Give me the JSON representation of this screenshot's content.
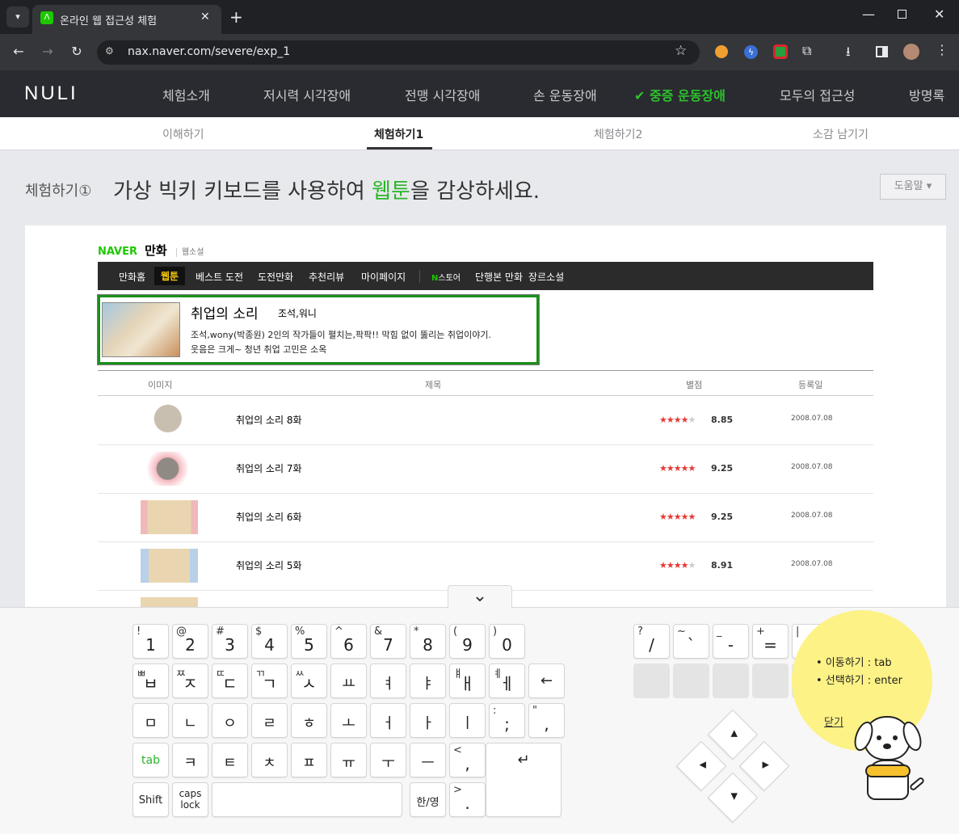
{
  "browser": {
    "tab_title": "온라인 웹 접근성 체험",
    "url": "nax.naver.com/severe/exp_1"
  },
  "nuli": {
    "logo": "NULI",
    "nav": [
      "체험소개",
      "저시력 시각장애",
      "전맹 시각장애",
      "손 운동장애",
      "중증 운동장애",
      "모두의 접근성",
      "방명록"
    ],
    "active_nav_check": "✔",
    "sub_nav": [
      "이해하기",
      "체험하기1",
      "체험하기2",
      "소감 남기기"
    ]
  },
  "page": {
    "step_label": "체험하기①",
    "title_before": "가상 빅키 키보드를 사용하여 ",
    "title_highlight": "웹툰",
    "title_after": "을 감상하세요.",
    "help_button": "도움말 ▾"
  },
  "naver": {
    "brand": "NAVER",
    "section": "만화",
    "sub_section": "웹소설",
    "menu": [
      "만화홈",
      "웹툰",
      "베스트 도전",
      "도전만화",
      "추천리뷰",
      "마이페이지"
    ],
    "store_n": "N",
    "store_label": "스토어",
    "store_items": [
      "단행본 만화",
      "장르소설"
    ],
    "featured": {
      "title": "취업의 소리",
      "authors": "조석,워니",
      "desc1": "조석,wony(박종원) 2인의 작가들이 펼치는,팍팍!! 막힘 없이 뚫리는 취업이야기.",
      "desc2": "웃음은 크게~ 청년 취업 고민은 소옥"
    },
    "table_headers": [
      "이미지",
      "제목",
      "별점",
      "등록일"
    ],
    "episodes": [
      {
        "title": "취업의 소리 8화",
        "rating": "8.85",
        "date": "2008.07.08"
      },
      {
        "title": "취업의 소리 7화",
        "rating": "9.25",
        "date": "2008.07.08"
      },
      {
        "title": "취업의 소리 6화",
        "rating": "9.25",
        "date": "2008.07.08"
      },
      {
        "title": "취업의 소리 5화",
        "rating": "8.91",
        "date": "2008.07.08"
      }
    ]
  },
  "keyboard": {
    "row1": [
      [
        "!",
        "1"
      ],
      [
        "@",
        "2"
      ],
      [
        "#",
        "3"
      ],
      [
        "$",
        "4"
      ],
      [
        "%",
        "5"
      ],
      [
        "^",
        "6"
      ],
      [
        "&",
        "7"
      ],
      [
        "*",
        "8"
      ],
      [
        "(",
        "9"
      ],
      [
        ")",
        "0"
      ]
    ],
    "row2": [
      [
        "ㅃ",
        "ㅂ"
      ],
      [
        "ㅉ",
        "ㅈ"
      ],
      [
        "ㄸ",
        "ㄷ"
      ],
      [
        "ㄲ",
        "ㄱ"
      ],
      [
        "ㅆ",
        "ㅅ"
      ],
      [
        "",
        "ㅛ"
      ],
      [
        "",
        "ㅕ"
      ],
      [
        "",
        "ㅑ"
      ],
      [
        "ㅒ",
        "ㅐ"
      ],
      [
        "ㅖ",
        "ㅔ"
      ]
    ],
    "backspace": "←",
    "row3": [
      [
        "",
        "ㅁ"
      ],
      [
        "",
        "ㄴ"
      ],
      [
        "",
        "ㅇ"
      ],
      [
        "",
        "ㄹ"
      ],
      [
        "",
        "ㅎ"
      ],
      [
        "",
        "ㅗ"
      ],
      [
        "",
        "ㅓ"
      ],
      [
        "",
        "ㅏ"
      ],
      [
        "",
        "ㅣ"
      ],
      [
        ":",
        ";"
      ],
      [
        "\"",
        ","
      ]
    ],
    "tab": "tab",
    "row4": [
      [
        "",
        "ㅋ"
      ],
      [
        "",
        "ㅌ"
      ],
      [
        "",
        "ㅊ"
      ],
      [
        "",
        "ㅍ"
      ],
      [
        "",
        "ㅠ"
      ],
      [
        "",
        "ㅜ"
      ],
      [
        "",
        "ㅡ"
      ],
      [
        "<",
        ","
      ]
    ],
    "enter": "↵",
    "shift": "Shift",
    "caps_top": "caps",
    "caps_bottom": "lock",
    "hanyoung": "한/영",
    "period_top": ">",
    "period": ".",
    "right_keys": [
      [
        "?",
        "/"
      ],
      [
        "~",
        "`"
      ],
      [
        "_",
        "-"
      ],
      [
        "+",
        "="
      ],
      [
        "|",
        ""
      ]
    ],
    "collapse": "⌄"
  },
  "help_bubble": {
    "line1": "• 이동하기 : tab",
    "line2": "• 선택하기 : enter",
    "close": "닫기"
  }
}
